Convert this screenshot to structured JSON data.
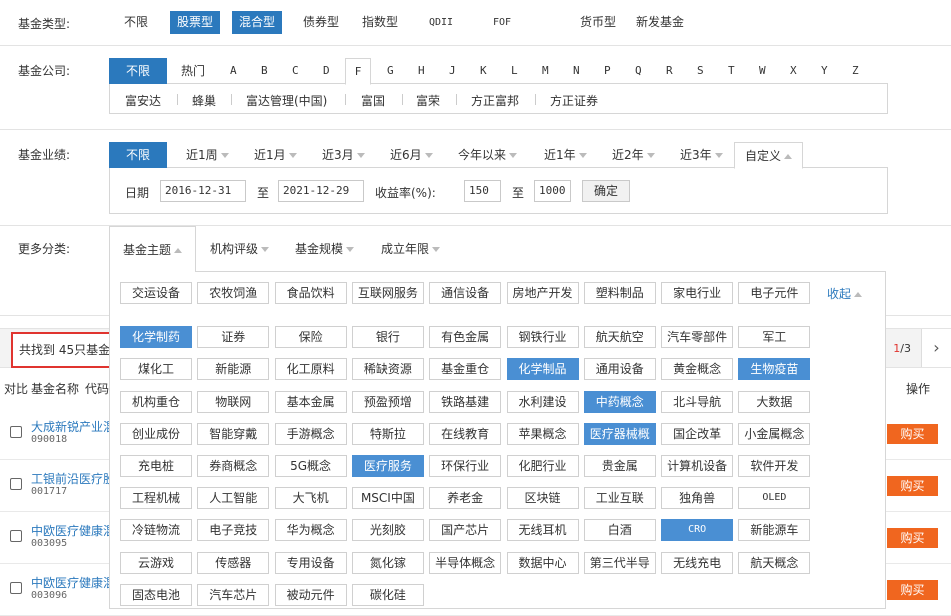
{
  "fund_type": {
    "label": "基金类型:",
    "options": [
      "不限",
      "股票型",
      "混合型",
      "债券型",
      "指数型",
      "QDII",
      "FOF",
      "货币型",
      "新发基金"
    ],
    "selected": [
      "股票型",
      "混合型"
    ]
  },
  "company": {
    "label": "基金公司:",
    "all": "不限",
    "hot": "热门",
    "letters": [
      "A",
      "B",
      "C",
      "D",
      "F",
      "G",
      "H",
      "J",
      "K",
      "L",
      "M",
      "N",
      "P",
      "Q",
      "R",
      "S",
      "T",
      "W",
      "X",
      "Y",
      "Z"
    ],
    "selected_letter": "F",
    "list": [
      "富安达",
      "蜂巢",
      "富达管理(中国)",
      "富国",
      "富荣",
      "方正富邦",
      "方正证券"
    ]
  },
  "performance": {
    "label": "基金业绩:",
    "all": "不限",
    "tabs": [
      "近1周",
      "近1月",
      "近3月",
      "近6月",
      "今年以来",
      "近1年",
      "近2年",
      "近3年"
    ],
    "custom": "自定义",
    "date_label": "日期",
    "date_from": "2016-12-31",
    "to_label": "至",
    "date_to": "2021-12-29",
    "yield_label": "收益率(%):",
    "yield_from": "150",
    "yield_to": "1000",
    "confirm": "确定"
  },
  "more": {
    "label": "更多分类:",
    "subtabs": [
      "基金主题",
      "机构评级",
      "基金规模",
      "成立年限"
    ],
    "collapse": "收起",
    "themes": [
      "交运设备",
      "农牧饲渔",
      "食品饮料",
      "互联网服务",
      "通信设备",
      "房地产开发",
      "塑料制品",
      "家电行业",
      "电子元件",
      "化学制药",
      "证券",
      "保险",
      "银行",
      "有色金属",
      "钢铁行业",
      "航天航空",
      "汽车零部件",
      "军工",
      "煤化工",
      "新能源",
      "化工原料",
      "稀缺资源",
      "基金重仓",
      "化学制品",
      "通用设备",
      "黄金概念",
      "生物疫苗",
      "机构重仓",
      "物联网",
      "基本金属",
      "预盈预增",
      "铁路基建",
      "水利建设",
      "中药概念",
      "北斗导航",
      "大数据",
      "创业成份",
      "智能穿戴",
      "手游概念",
      "特斯拉",
      "在线教育",
      "苹果概念",
      "医疗器械概",
      "国企改革",
      "小金属概念",
      "充电桩",
      "券商概念",
      "5G概念",
      "医疗服务",
      "环保行业",
      "化肥行业",
      "贵金属",
      "计算机设备",
      "软件开发",
      "工程机械",
      "人工智能",
      "大飞机",
      "MSCI中国",
      "养老金",
      "区块链",
      "工业互联",
      "独角兽",
      "OLED",
      "冷链物流",
      "电子竞技",
      "华为概念",
      "光刻胶",
      "国产芯片",
      "无线耳机",
      "白酒",
      "CRO",
      "新能源车",
      "云游戏",
      "传感器",
      "专用设备",
      "氮化镓",
      "半导体概念",
      "数据中心",
      "第三代半导",
      "无线充电",
      "航天概念",
      "固态电池",
      "汽车芯片",
      "被动元件",
      "碳化硅"
    ],
    "selected_themes": [
      "化学制药",
      "化学制品",
      "生物疫苗",
      "中药概念",
      "医疗器械概",
      "医疗服务",
      "CRO"
    ]
  },
  "results": {
    "found_text": "共找到 45只基金",
    "page_current": "1",
    "page_total": "/3",
    "next_icon": "›"
  },
  "table": {
    "headers": [
      "对比",
      "基金名称",
      "代码",
      "操作"
    ],
    "rows": [
      {
        "name": "大成新锐产业混合",
        "code": "090018"
      },
      {
        "name": "工银前沿医疗股票",
        "code": "001717"
      },
      {
        "name": "中欧医疗健康混合",
        "code": "003095"
      },
      {
        "name": "中欧医疗健康混合",
        "code": "003096"
      }
    ],
    "buy_label": "购买"
  },
  "colors": {
    "accent": "#2b79bd",
    "tag_selected": "#4a8fd3",
    "buy": "#f0661f",
    "highlight_border": "#e0342f"
  }
}
